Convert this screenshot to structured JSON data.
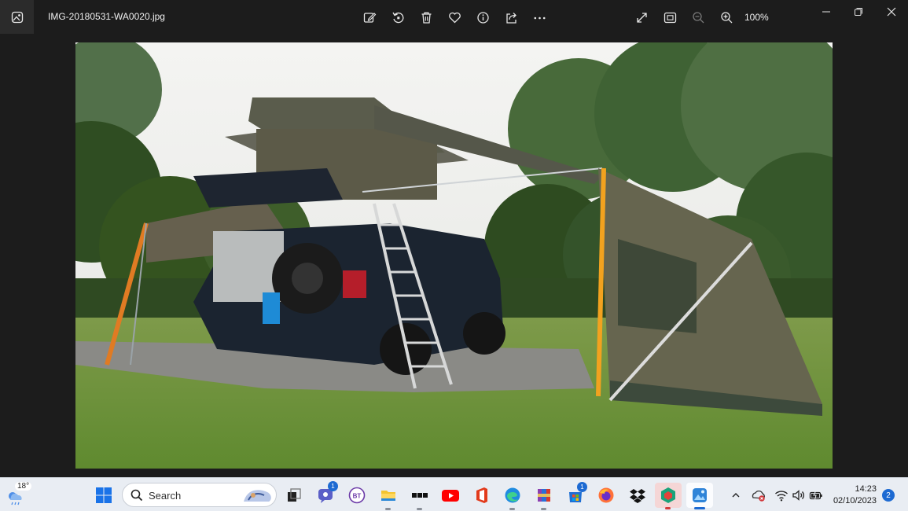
{
  "window": {
    "title": "IMG-20180531-WA0020.jpg",
    "zoom_level": "100%"
  },
  "toolbar": {
    "icons": [
      "edit-image-icon",
      "rotate-icon",
      "delete-icon",
      "favorite-icon",
      "file-info-icon",
      "share-icon",
      "more-icon"
    ],
    "right_icons": [
      "fullscreen-icon",
      "fit-to-window-icon",
      "zoom-out-icon",
      "zoom-in-icon"
    ]
  },
  "window_controls": [
    "minimize-icon",
    "restore-icon",
    "close-icon"
  ],
  "taskbar": {
    "weather_temp": "18°",
    "search_placeholder": "Search",
    "pinned": [
      {
        "name": "start-button",
        "icon": "windows-logo-icon"
      },
      {
        "name": "task-view-button",
        "icon": "task-view-icon"
      },
      {
        "name": "teams-chat-button",
        "icon": "teams-icon",
        "badge": "1"
      },
      {
        "name": "bt-app-button",
        "icon": "bt-icon"
      },
      {
        "name": "file-explorer-button",
        "icon": "folder-icon"
      },
      {
        "name": "dots-app-button",
        "icon": "dots-app-icon"
      },
      {
        "name": "youtube-button",
        "icon": "youtube-icon"
      },
      {
        "name": "office-button",
        "icon": "office-icon"
      },
      {
        "name": "edge-button",
        "icon": "edge-icon"
      },
      {
        "name": "winrar-button",
        "icon": "archive-icon"
      },
      {
        "name": "store-button",
        "icon": "store-icon",
        "badge": "1"
      },
      {
        "name": "firefox-button",
        "icon": "firefox-icon"
      },
      {
        "name": "dropbox-button",
        "icon": "dropbox-icon"
      },
      {
        "name": "security-app-button",
        "icon": "shield-app-icon"
      },
      {
        "name": "photos-button",
        "icon": "photos-icon"
      }
    ],
    "tray_icons": [
      "show-hidden-icons-chevron",
      "onedrive-error-icon",
      "wifi-icon",
      "volume-icon",
      "battery-icon"
    ],
    "time": "14:23",
    "date": "02/10/2023",
    "notification_count": "2"
  },
  "colors": {
    "app_background": "#1c1c1c",
    "taskbar_background": "#e9edf3",
    "accent": "#1d6ad2"
  }
}
